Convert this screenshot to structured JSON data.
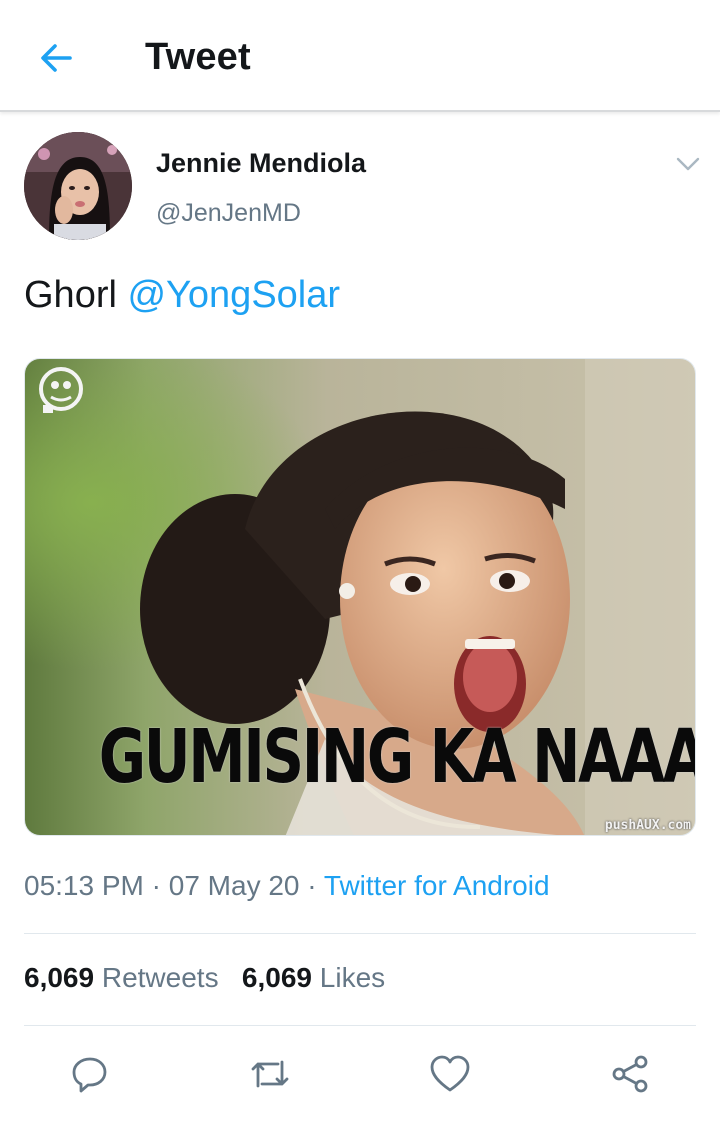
{
  "header": {
    "title": "Tweet",
    "back_icon": "arrow-left-icon"
  },
  "author": {
    "display_name": "Jennie Mendiola",
    "handle": "@JenJenMD",
    "menu_icon": "chevron-down-icon"
  },
  "tweet": {
    "text": "Ghorl",
    "mention": "@YongSolar"
  },
  "media": {
    "caption": "GUMISING KA NAAA!!!",
    "watermark": "pushAUX.com"
  },
  "meta": {
    "time": "05:13 PM",
    "separator": "·",
    "date": "07 May 20",
    "source": "Twitter for Android"
  },
  "stats": {
    "retweets_count": "6,069",
    "retweets_label": "Retweets",
    "likes_count": "6,069",
    "likes_label": "Likes"
  },
  "actions": {
    "reply_icon": "reply-icon",
    "retweet_icon": "retweet-icon",
    "like_icon": "heart-icon",
    "share_icon": "share-icon"
  },
  "colors": {
    "accent": "#1da1f2",
    "text": "#14171a",
    "secondary": "#657786",
    "divider": "#e1e8ed"
  }
}
